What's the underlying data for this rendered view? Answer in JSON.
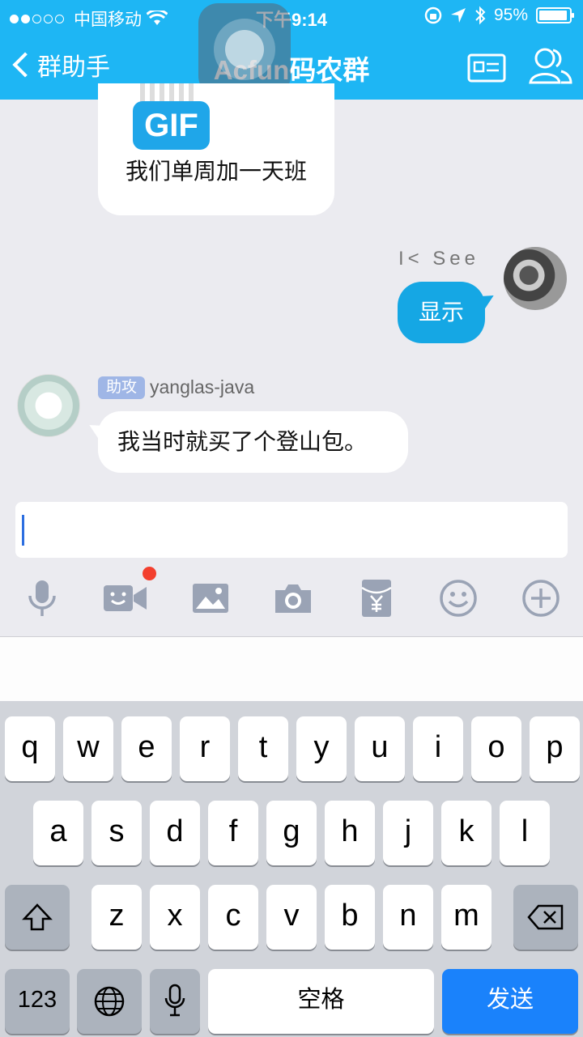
{
  "status_bar": {
    "carrier": "中国移动",
    "time": "下午9:14",
    "battery": "95%",
    "battery_level": 0.95
  },
  "nav": {
    "back_label": "群助手",
    "title": "Acfun码农群"
  },
  "messages": {
    "gif_badge": "GIF",
    "gif_caption": "我们单周加一天班",
    "outgoing_sender": "I< See",
    "outgoing_text": "显示",
    "incoming_tag": "助攻",
    "incoming_sender": "yanglas-java",
    "incoming_text": "我当时就买了个登山包。"
  },
  "input": {
    "value": ""
  },
  "toolbar": {
    "icons": [
      "microphone-icon",
      "video-call-icon",
      "image-icon",
      "camera-icon",
      "red-packet-icon",
      "emoji-icon",
      "plus-icon"
    ],
    "badge_color": "#f33f2e"
  },
  "keyboard": {
    "row1": [
      "q",
      "w",
      "e",
      "r",
      "t",
      "y",
      "u",
      "i",
      "o",
      "p"
    ],
    "row2": [
      "a",
      "s",
      "d",
      "f",
      "g",
      "h",
      "j",
      "k",
      "l"
    ],
    "row3": [
      "z",
      "x",
      "c",
      "v",
      "b",
      "n",
      "m"
    ],
    "numbers_key": "123",
    "space_key": "空格",
    "send_key": "发送",
    "accent": "#1a82fb"
  },
  "colors": {
    "header": "#1eb6f4",
    "outgoing_bubble": "#15a7e4"
  }
}
